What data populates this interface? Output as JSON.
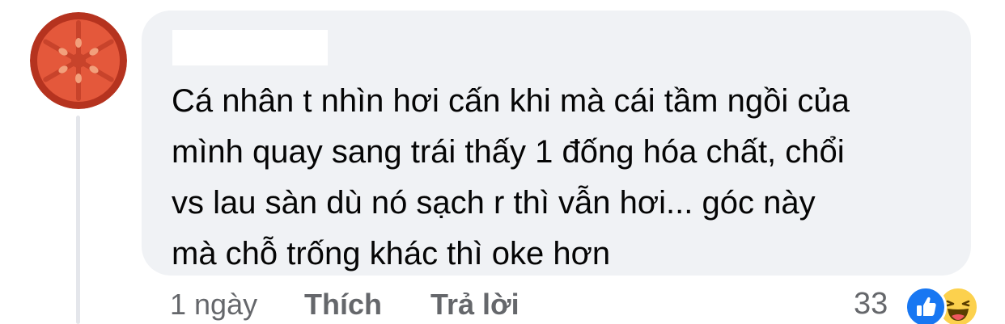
{
  "comment": {
    "author_redacted": "",
    "text_lines": [
      "Cá nhân t nhìn hơi cấn khi mà cái tầm ngồi của",
      "mình quay sang trái thấy 1 đống hóa chất, chổi",
      "vs lau sàn dù nó sạch r thì vẫn hơi... góc này",
      "mà chỗ trống khác thì oke hơn"
    ]
  },
  "actions": {
    "time": "1 ngày",
    "like_label": "Thích",
    "reply_label": "Trả lời"
  },
  "reactions": {
    "count": "33",
    "icons": [
      "like-icon",
      "haha-icon"
    ]
  },
  "colors": {
    "bubble_bg": "#f0f2f5",
    "meta_text": "#65676b",
    "like_blue": "#1877f2",
    "haha_yellow": "#fcd14d",
    "avatar_red": "#e4583b"
  }
}
